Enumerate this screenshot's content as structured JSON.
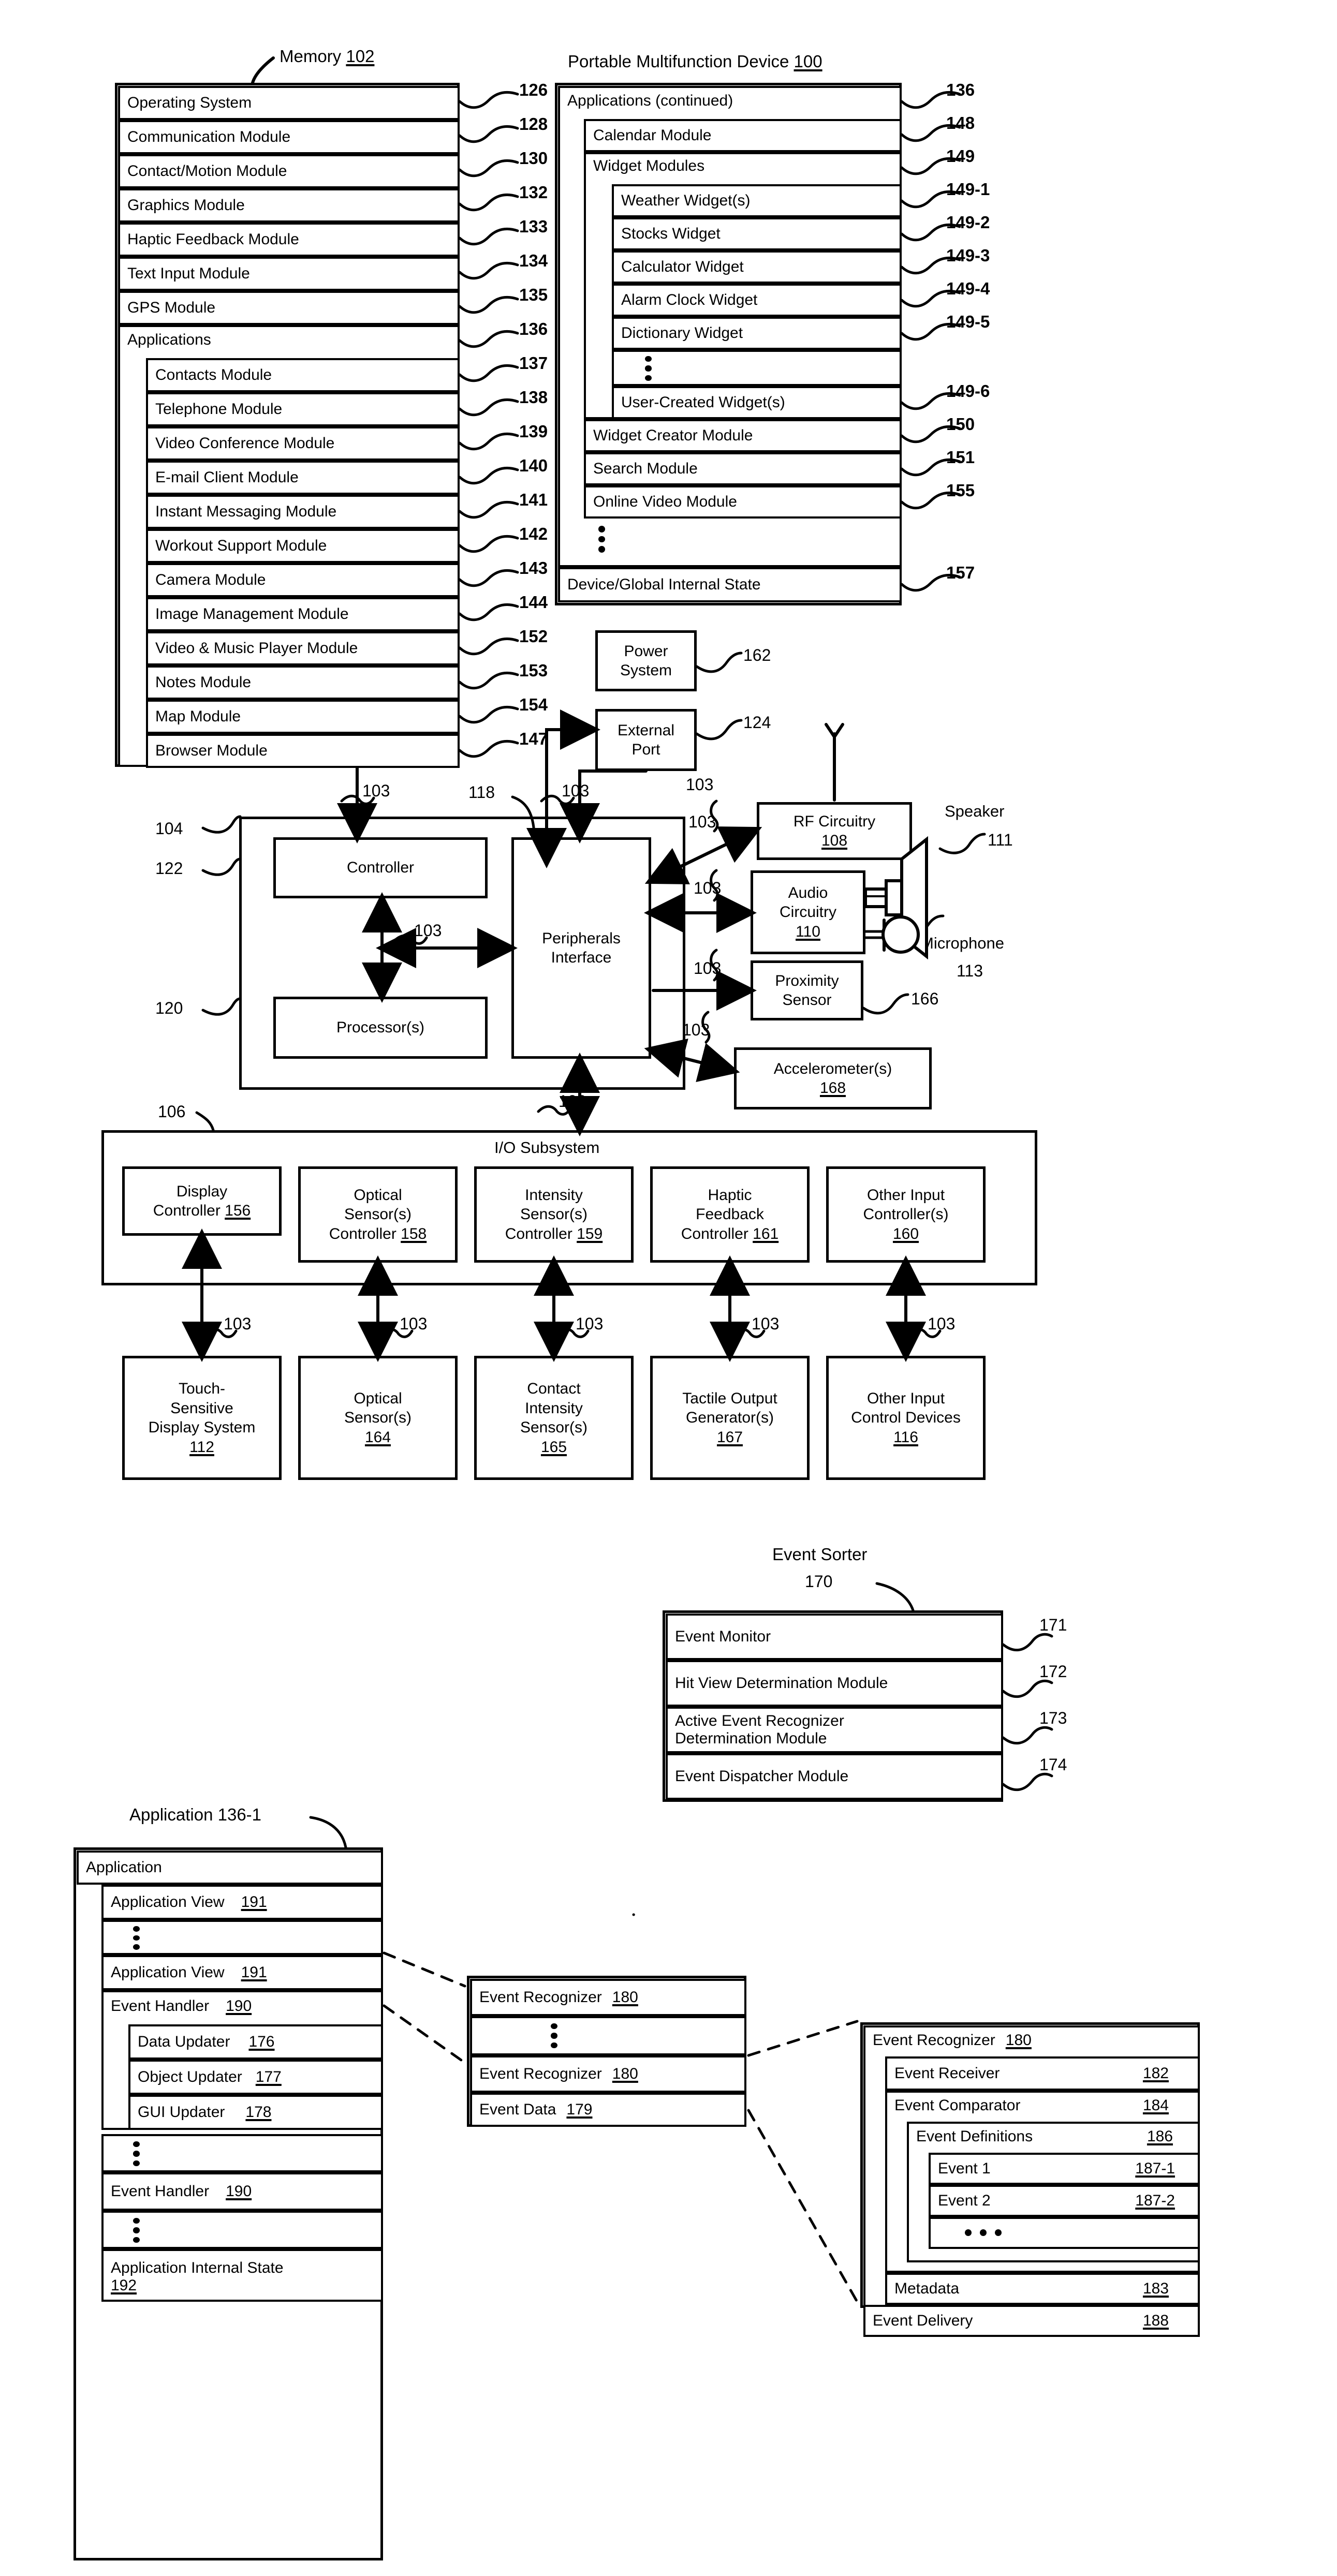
{
  "figure": {
    "memory_title": "Memory",
    "memory_ref": "102",
    "device_title": "Portable Multifunction Device",
    "device_ref": "100"
  },
  "memory_column": {
    "items": [
      {
        "label": "Operating System",
        "ref": "126"
      },
      {
        "label": "Communication Module",
        "ref": "128"
      },
      {
        "label": "Contact/Motion Module",
        "ref": "130"
      },
      {
        "label": "Graphics Module",
        "ref": "132"
      },
      {
        "label": "Haptic Feedback Module",
        "ref": "133"
      },
      {
        "label": "Text Input Module",
        "ref": "134"
      },
      {
        "label": "GPS Module",
        "ref": "135"
      },
      {
        "label": "Applications",
        "ref": "136"
      }
    ],
    "applications": [
      {
        "label": "Contacts Module",
        "ref": "137"
      },
      {
        "label": "Telephone Module",
        "ref": "138"
      },
      {
        "label": "Video Conference Module",
        "ref": "139"
      },
      {
        "label": "E-mail Client Module",
        "ref": "140"
      },
      {
        "label": "Instant Messaging Module",
        "ref": "141"
      },
      {
        "label": "Workout Support Module",
        "ref": "142"
      },
      {
        "label": "Camera Module",
        "ref": "143"
      },
      {
        "label": "Image Management Module",
        "ref": "144"
      },
      {
        "label": "Video & Music Player Module",
        "ref": "152"
      },
      {
        "label": "Notes Module",
        "ref": "153"
      },
      {
        "label": "Map Module",
        "ref": "154"
      },
      {
        "label": "Browser Module",
        "ref": "147"
      }
    ]
  },
  "device_column": {
    "header": {
      "label": "Applications (continued)",
      "ref": "136"
    },
    "items": [
      {
        "label": "Calendar Module",
        "ref": "148"
      },
      {
        "label": "Widget Modules",
        "ref": "149"
      }
    ],
    "widgets": [
      {
        "label": "Weather Widget(s)",
        "ref": "149-1"
      },
      {
        "label": "Stocks Widget",
        "ref": "149-2"
      },
      {
        "label": "Calculator Widget",
        "ref": "149-3"
      },
      {
        "label": "Alarm Clock Widget",
        "ref": "149-4"
      },
      {
        "label": "Dictionary Widget",
        "ref": "149-5"
      },
      {
        "label": "",
        "ref": ""
      },
      {
        "label": "User-Created Widget(s)",
        "ref": "149-6"
      }
    ],
    "tail": [
      {
        "label": "Widget Creator Module",
        "ref": "150"
      },
      {
        "label": "Search Module",
        "ref": "151"
      },
      {
        "label": "Online Video Module",
        "ref": "155"
      }
    ],
    "global_state": {
      "label": "Device/Global Internal State",
      "ref": "157"
    }
  },
  "system_blocks": {
    "power_system": {
      "line1": "Power",
      "line2": "System",
      "ref": "162"
    },
    "external_port": {
      "line1": "External",
      "line2": "Port",
      "ref": "124"
    },
    "rf_circuitry": {
      "label": "RF Circuitry",
      "ref": "108"
    },
    "audio_circuitry": {
      "line1": "Audio",
      "line2": "Circuitry",
      "ref": "110"
    },
    "proximity_sensor": {
      "line1": "Proximity",
      "line2": "Sensor",
      "ref": "166"
    },
    "accelerometer": {
      "label": "Accelerometer(s)",
      "ref": "168"
    },
    "speaker": {
      "label": "Speaker",
      "ref": "111"
    },
    "microphone": {
      "label": "Microphone",
      "ref": "113"
    },
    "controller": {
      "label": "Controller",
      "ref": "122"
    },
    "processor": {
      "label": "Processor(s)",
      "ref": "120"
    },
    "peripherals_interface": {
      "line1": "Peripherals",
      "line2": "Interface",
      "ref": "118"
    },
    "cpu_group_ref": "104",
    "bus_ref": "103"
  },
  "io_subsystem": {
    "title": "I/O Subsystem",
    "ref": "106",
    "controllers": [
      {
        "line1": "Display",
        "line2": "Controller",
        "ref": "156"
      },
      {
        "line1": "Optical",
        "line2": "Sensor(s)",
        "line3": "Controller",
        "ref": "158"
      },
      {
        "line1": "Intensity",
        "line2": "Sensor(s)",
        "line3": "Controller",
        "ref": "159"
      },
      {
        "line1": "Haptic",
        "line2": "Feedback",
        "line3": "Controller",
        "ref": "161"
      },
      {
        "line1": "Other Input",
        "line2": "Controller(s)",
        "ref": "160"
      }
    ],
    "devices": [
      {
        "line1": "Touch-",
        "line2": "Sensitive",
        "line3": "Display System",
        "ref": "112"
      },
      {
        "line1": "Optical",
        "line2": "Sensor(s)",
        "ref": "164"
      },
      {
        "line1": "Contact",
        "line2": "Intensity",
        "line3": "Sensor(s)",
        "ref": "165"
      },
      {
        "line1": "Tactile Output",
        "line2": "Generator(s)",
        "ref": "167"
      },
      {
        "line1": "Other Input",
        "line2": "Control Devices",
        "ref": "116"
      }
    ]
  },
  "event_sorter": {
    "title": "Event Sorter",
    "ref": "170",
    "rows": [
      {
        "label": "Event Monitor",
        "ref": "171"
      },
      {
        "label": "Hit View Determination Module",
        "ref": "172"
      },
      {
        "label": "Active Event Recognizer Determination Module",
        "ref": "173"
      },
      {
        "label": "Event Dispatcher Module",
        "ref": "174"
      }
    ],
    "row3_line1": "Active Event Recognizer",
    "row3_line2": "Determination Module"
  },
  "application": {
    "title": "Application 136-1",
    "header": "Application",
    "rows": [
      {
        "label": "Application View",
        "ref": "191"
      },
      {
        "label": "Application View",
        "ref": "191"
      },
      {
        "label": "Event Handler",
        "ref": "190"
      },
      {
        "label": "Event Handler",
        "ref": "190"
      }
    ],
    "handler_children": [
      {
        "label": "Data Updater",
        "ref": "176"
      },
      {
        "label": "Object Updater",
        "ref": "177"
      },
      {
        "label": "GUI Updater",
        "ref": "178"
      }
    ],
    "internal_state": {
      "label": "Application Internal State",
      "ref": "192"
    }
  },
  "event_recognizer_list": {
    "rows": [
      {
        "label": "Event Recognizer",
        "ref": "180"
      },
      {
        "label": "Event Recognizer",
        "ref": "180"
      },
      {
        "label": "Event Data",
        "ref": "179"
      }
    ]
  },
  "event_recognizer_detail": {
    "title": {
      "label": "Event Recognizer",
      "ref": "180"
    },
    "rows": [
      {
        "label": "Event Receiver",
        "ref": "182"
      },
      {
        "label": "Event Comparator",
        "ref": "184"
      }
    ],
    "definitions": {
      "label": "Event Definitions",
      "ref": "186"
    },
    "events": [
      {
        "label": "Event 1",
        "ref": "187-1"
      },
      {
        "label": "Event 2",
        "ref": "187-2"
      }
    ],
    "footer": [
      {
        "label": "Metadata",
        "ref": "183"
      },
      {
        "label": "Event Delivery",
        "ref": "188"
      }
    ]
  }
}
